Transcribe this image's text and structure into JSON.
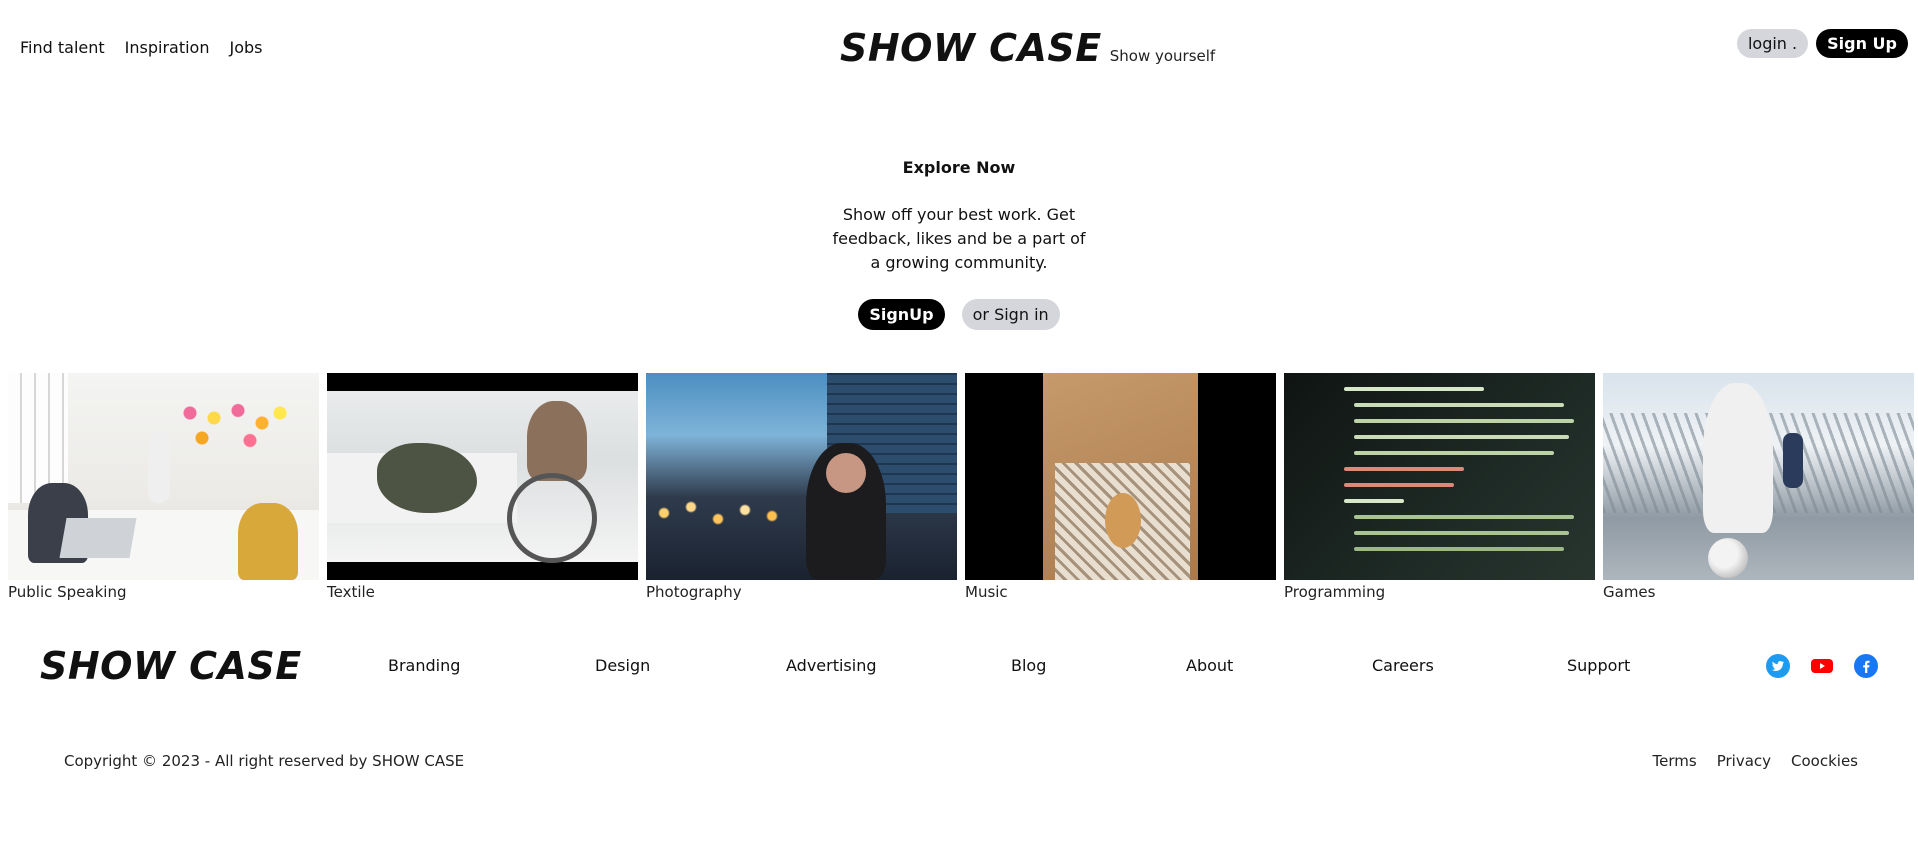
{
  "header": {
    "nav": [
      "Find talent",
      "Inspiration",
      "Jobs"
    ],
    "brand": "SHOW CASE",
    "tagline": "Show yourself",
    "login_label": "login .",
    "signup_label": "Sign Up"
  },
  "hero": {
    "title": "Explore Now",
    "text": "Show off your best work. Get feedback, likes and be a part of a growing community.",
    "signup_label": "SignUp",
    "signin_label": "or Sign in"
  },
  "categories": [
    {
      "label": "Public Speaking",
      "icon": "meeting-photo"
    },
    {
      "label": "Textile",
      "icon": "sewing-photo"
    },
    {
      "label": "Photography",
      "icon": "camera-photo"
    },
    {
      "label": "Music",
      "icon": "guitar-photo"
    },
    {
      "label": "Programming",
      "icon": "code-photo"
    },
    {
      "label": "Games",
      "icon": "football-photo"
    }
  ],
  "footer": {
    "brand": "SHOW CASE",
    "nav": [
      "Branding",
      "Design",
      "Advertising",
      "Blog",
      "About",
      "Careers",
      "Support"
    ],
    "social": [
      {
        "name": "twitter-icon",
        "color": "#1d9bf0"
      },
      {
        "name": "youtube-icon",
        "color": "#ff0000"
      },
      {
        "name": "facebook-icon",
        "color": "#1877f2"
      }
    ],
    "copyright": "Copyright © 2023 - All right reserved by SHOW CASE",
    "legal": [
      "Terms",
      "Privacy",
      "Coockies"
    ]
  }
}
